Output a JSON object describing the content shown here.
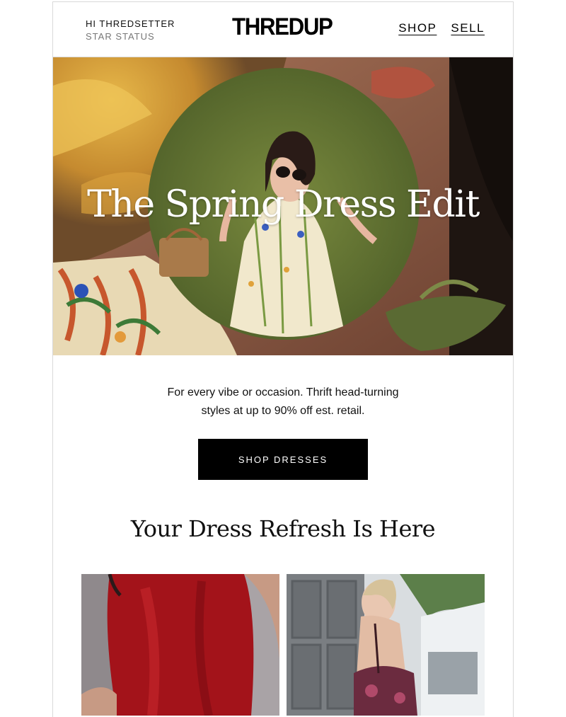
{
  "header": {
    "greeting": "HI THREDSETTER",
    "status": "STAR STATUS",
    "logo": "THREDUP",
    "nav": [
      "SHOP",
      "SELL"
    ]
  },
  "hero": {
    "title": "The Spring Dress Edit"
  },
  "intro": {
    "line1": "For every vibe or occasion. Thrift head-turning",
    "line2": "styles at up to 90% off est. retail."
  },
  "cta": {
    "label": "SHOP DRESSES"
  },
  "section": {
    "title": "Your Dress Refresh Is Here"
  },
  "products": [
    {
      "image": "red-satin-dress-photo"
    },
    {
      "image": "backless-print-dress-photo"
    }
  ],
  "colors": {
    "accent": "#000000",
    "background": "#ffffff",
    "border": "#d9d9d9"
  }
}
